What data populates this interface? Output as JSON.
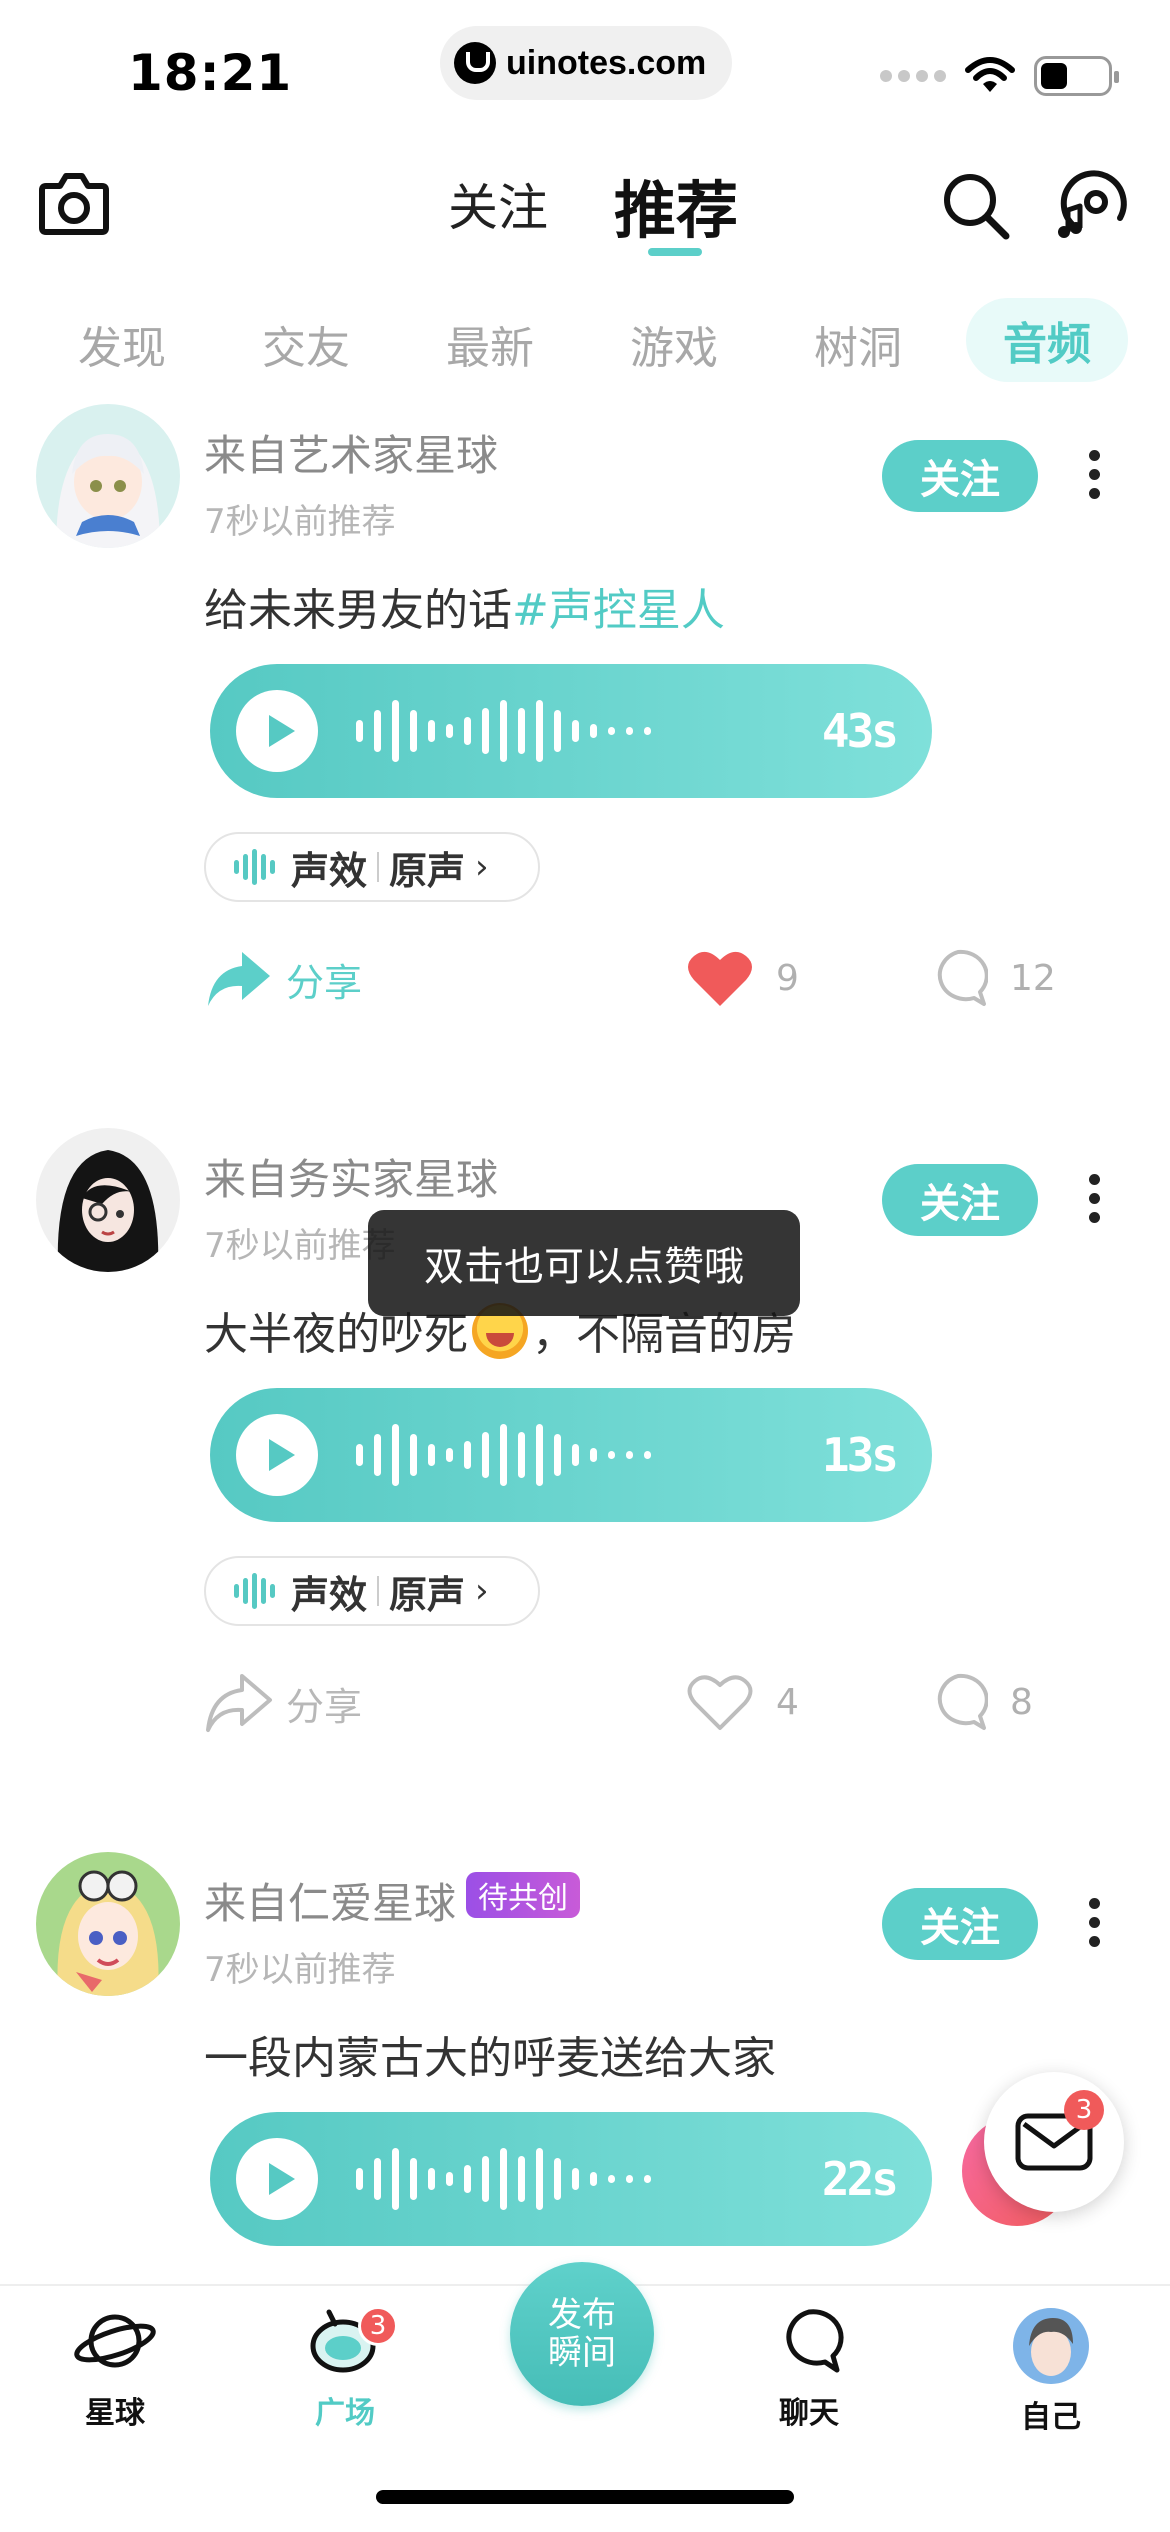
{
  "status_bar": {
    "time": "18:21",
    "url": "uinotes.com"
  },
  "header": {
    "tab_follow": "关注",
    "tab_recommend": "推荐"
  },
  "categories": [
    {
      "label": "发现"
    },
    {
      "label": "交友"
    },
    {
      "label": "最新"
    },
    {
      "label": "游戏"
    },
    {
      "label": "树洞"
    }
  ],
  "category_active": "音频",
  "posts": [
    {
      "planet": "来自艺术家星球",
      "time": "7秒以前推荐",
      "follow_label": "关注",
      "text": "给未来男友的话",
      "tag": "#声控星人",
      "duration": "43s",
      "effect_a": "声效",
      "effect_b": "原声",
      "share_label": "分享",
      "likes": "9",
      "liked": true,
      "comments": "12"
    },
    {
      "planet": "来自务实家星球",
      "time": "7秒以前推荐",
      "follow_label": "关注",
      "text_before": "大半夜的吵死",
      "text_after": "，不隔音的房",
      "emoji": "crying-laughing-emoji",
      "duration": "13s",
      "effect_a": "声效",
      "effect_b": "原声",
      "share_label": "分享",
      "likes": "4",
      "liked": false,
      "comments": "8"
    },
    {
      "planet": "来自仁爱星球",
      "badge": "待共创",
      "time": "7秒以前推荐",
      "follow_label": "关注",
      "text": "一段内蒙古大的呼麦送给大家",
      "duration": "22s"
    }
  ],
  "toast": "双击也可以点赞哦",
  "message_badge": "3",
  "tabbar": {
    "planet": "星球",
    "square": "广场",
    "square_badge": "3",
    "publish": "发布瞬间",
    "chat": "聊天",
    "me": "自己"
  },
  "colors": {
    "accent": "#5ccfc9",
    "like_red": "#f05a5a",
    "badge_purple": "#9b4fe6"
  }
}
